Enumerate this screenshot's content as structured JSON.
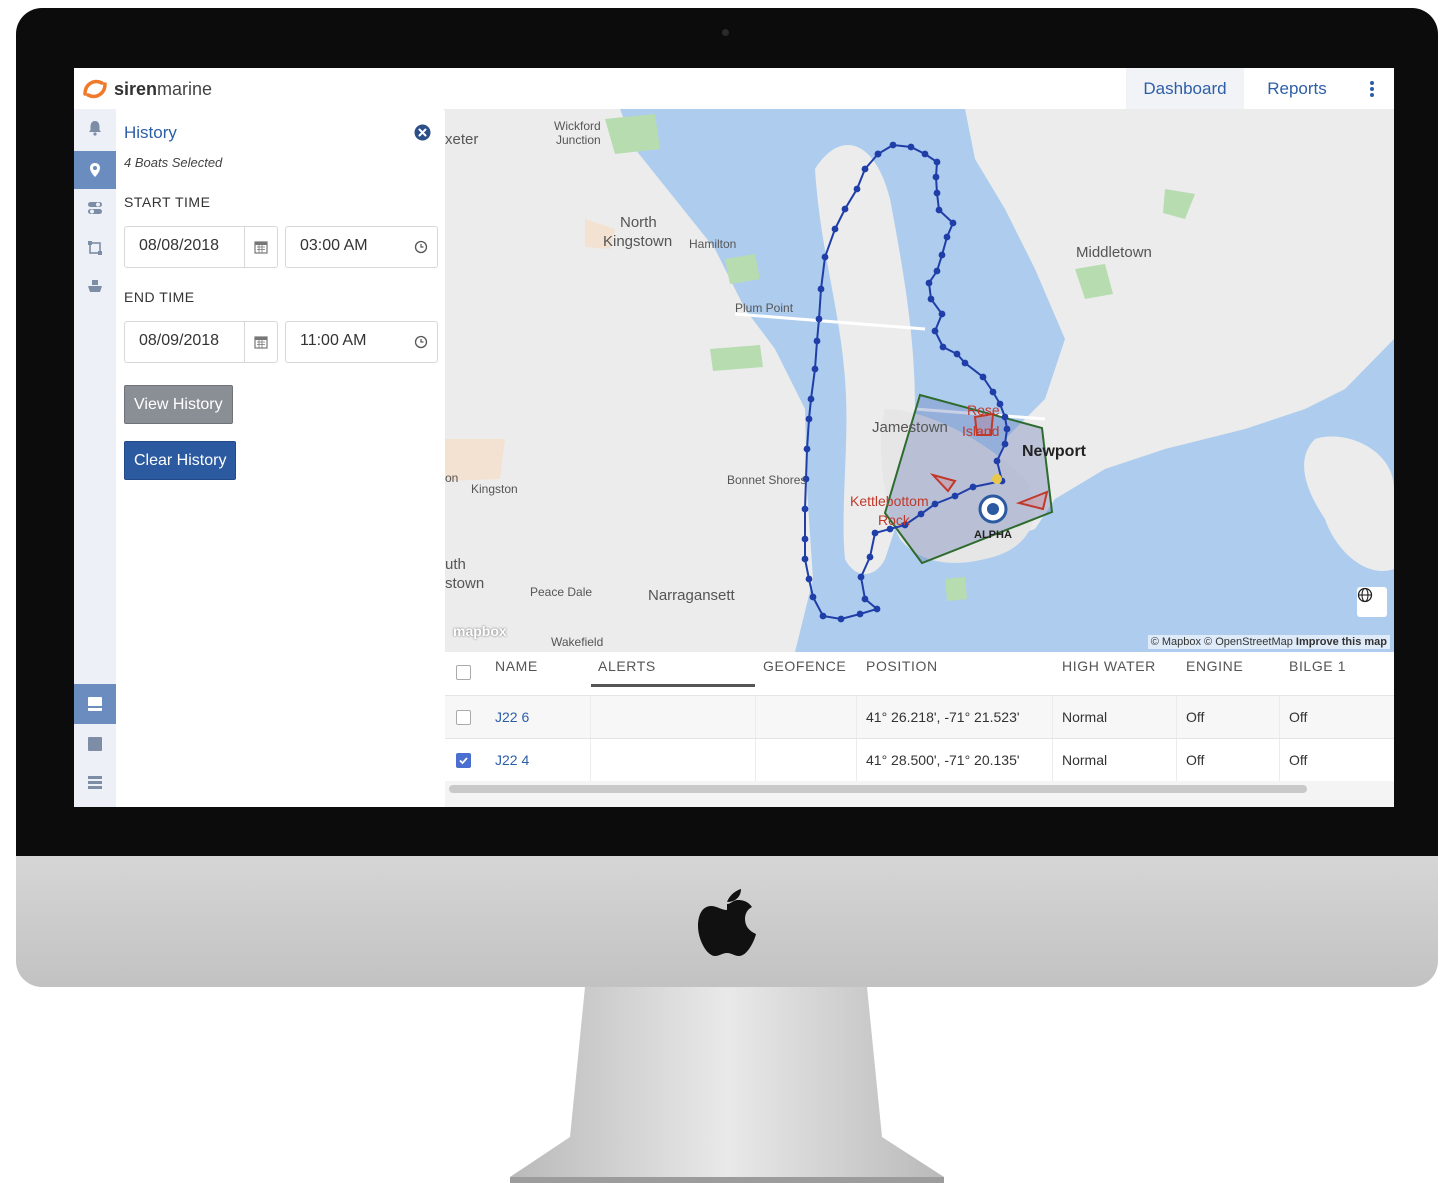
{
  "app": {
    "brand_bold": "siren",
    "brand_light": "marine"
  },
  "nav": {
    "dashboard": "Dashboard",
    "reports": "Reports"
  },
  "rail": {
    "top_icons": [
      "bell-icon",
      "map-pin-icon",
      "toggle-icon",
      "geofence-square-icon",
      "boat-icon"
    ],
    "bottom_icons": [
      "panel-layout-icon",
      "square-layout-icon",
      "list-layout-icon"
    ]
  },
  "history": {
    "title": "History",
    "subtitle": "4 Boats Selected",
    "start_label": "START TIME",
    "start_date": "08/08/2018",
    "start_time": "03:00 AM",
    "end_label": "END TIME",
    "end_date": "08/09/2018",
    "end_time": "11:00 AM",
    "view_button": "View History",
    "clear_button": "Clear History"
  },
  "map": {
    "labels": {
      "wickford": "Wickford",
      "junction": "Junction",
      "exeter": "xeter",
      "north": "North",
      "kingstown": "Kingstown",
      "hamilton": "Hamilton",
      "middletown": "Middletown",
      "plum_point": "Plum Point",
      "jamestown": "Jamestown",
      "rose": "Rose",
      "island": "Island",
      "newport": "Newport",
      "bonnet_shores": "Bonnet Shores",
      "kingston": "Kingston",
      "on": "on",
      "kettlebottom": "Kettlebottom",
      "rock": "Rock",
      "alpha": "ALPHA",
      "uth": "uth",
      "stown": "stown",
      "peace_dale": "Peace Dale",
      "narragansett": "Narragansett",
      "wakefield": "Wakefield",
      "mapbox_logo": "mapbox"
    },
    "attribution": "© Mapbox © OpenStreetMap",
    "attribution_link": "Improve this map",
    "colors": {
      "water": "#aecdee",
      "land": "#ececec",
      "track": "#1f3ea8",
      "geofence": "#2e6b2e",
      "alert": "#c0392b"
    }
  },
  "table": {
    "headers": {
      "name": "NAME",
      "alerts": "ALERTS",
      "geofence": "GEOFENCE",
      "position": "POSITION",
      "high_water": "HIGH WATER",
      "engine": "ENGINE",
      "bilge": "BILGE 1"
    },
    "rows": [
      {
        "checked": false,
        "name": "J22 6",
        "position": "41° 26.218', -71° 21.523'",
        "high_water": "Normal",
        "engine": "Off",
        "bilge": "Off"
      },
      {
        "checked": true,
        "name": "J22 4",
        "position": "41° 28.500', -71° 20.135'",
        "high_water": "Normal",
        "engine": "Off",
        "bilge": "Off"
      }
    ]
  }
}
